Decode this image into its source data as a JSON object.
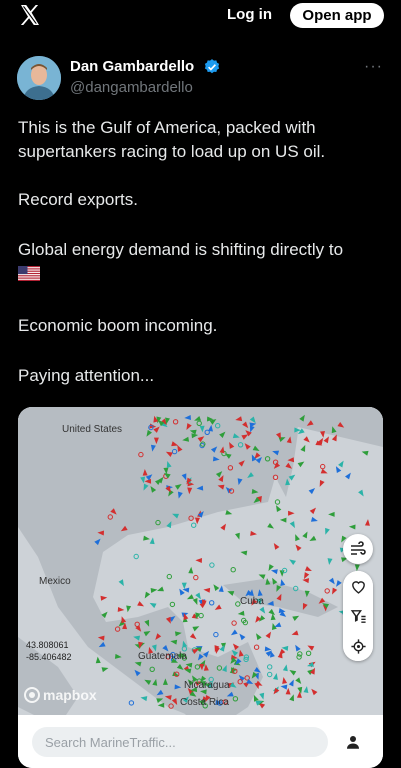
{
  "header": {
    "login_label": "Log in",
    "open_app_label": "Open app",
    "logo_icon": "x-logo-icon"
  },
  "author": {
    "name": "Dan Gambardello",
    "handle": "@dangambardello",
    "verified_color": "#1d9bf0"
  },
  "tweet": {
    "lines": [
      "This is the Gulf of America, packed with supertankers racing to load up on US oil.",
      "Record exports.",
      "Global energy demand is shifting directly to",
      "Economic boom incoming.",
      "Paying attention..."
    ],
    "flag_icon": "us-flag-icon"
  },
  "map": {
    "labels": {
      "us": "United States",
      "mexico": "Mexico",
      "cuba": "Cuba",
      "guatemala": "Guatemala",
      "nicaragua": "Nicaragua",
      "costa_rica": "Costa Rica"
    },
    "coords": {
      "lat": "43.808061",
      "lon": "-85.406482"
    },
    "attribution": "mapbox",
    "search_placeholder": "Search MarineTraffic...",
    "vessel_colors": {
      "cargo": "#2e9e3a",
      "tanker": "#d32f2f",
      "passenger": "#1e6fd9",
      "other": "#2bb3a8"
    }
  }
}
